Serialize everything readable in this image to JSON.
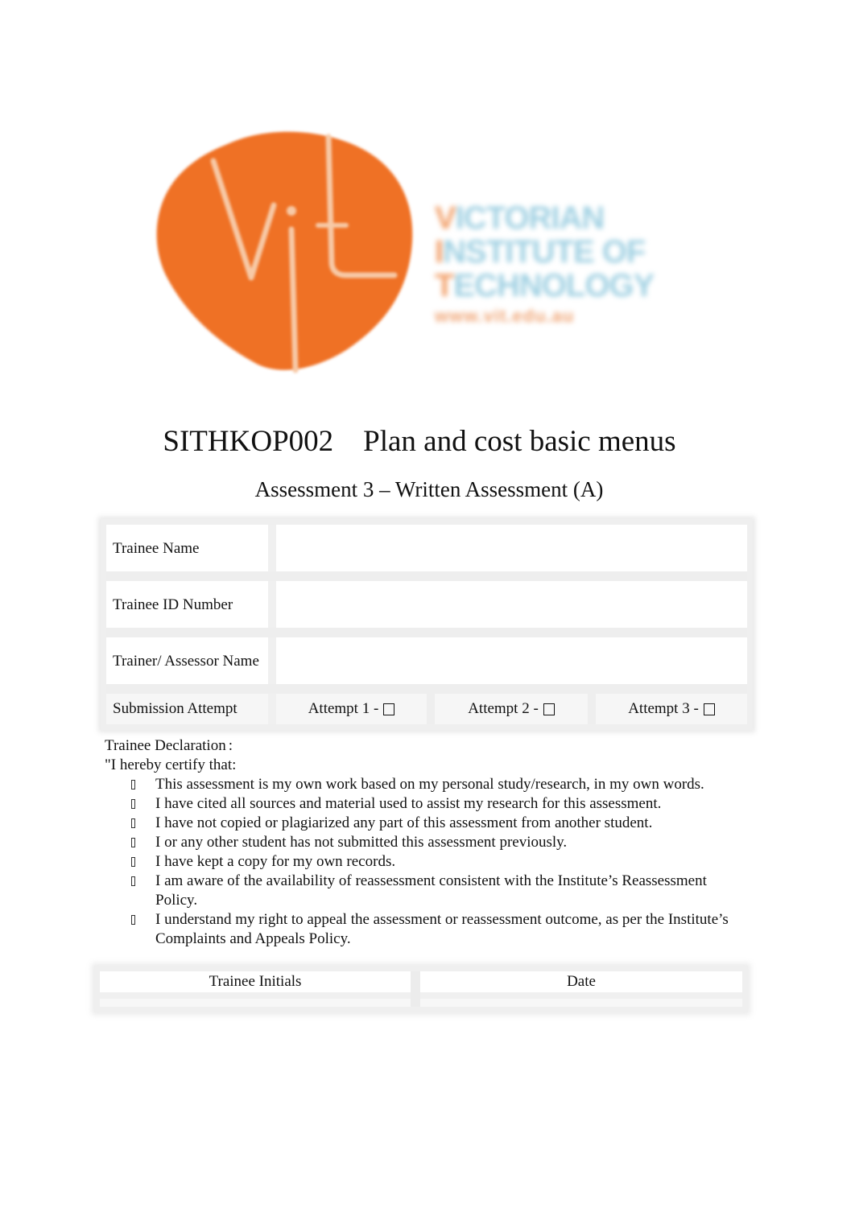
{
  "logo": {
    "initials": "vit",
    "name_lines": [
      {
        "initial": "V",
        "rest": "ICTORIAN"
      },
      {
        "initial": "I",
        "rest": "NSTITUTE OF"
      },
      {
        "initial": "T",
        "rest": "ECHNOLOGY"
      }
    ],
    "url": "www.vit.edu.au",
    "colors": {
      "mark": "#ef7125",
      "text": "#9fd0e2",
      "accent": "#f2a06a"
    }
  },
  "header": {
    "unit_code_title": "SITHKOP002    Plan and cost basic menus",
    "subtitle": "Assessment 3 – Written Assessment (A)"
  },
  "info_table": {
    "rows": [
      {
        "label": "Trainee Name",
        "value": ""
      },
      {
        "label": "Trainee ID Number",
        "value": ""
      },
      {
        "label": "Trainer/ Assessor Name",
        "value": ""
      }
    ],
    "submission": {
      "label": "Submission Attempt",
      "attempts": [
        {
          "label": "Attempt 1 - ",
          "checked": false
        },
        {
          "label": "Attempt 2 - ",
          "checked": false
        },
        {
          "label": "Attempt 3 - ",
          "checked": false
        }
      ]
    }
  },
  "declaration": {
    "heading": "Trainee Declaration",
    "heading_colon": ":",
    "intro": "\"I hereby certify that:",
    "items": [
      "This assessment is my own work based on my personal study/research, in my own words.",
      "I have cited all sources and material used to assist my research for this assessment.",
      "I have not copied or plagiarized any part of this assessment from another student.",
      "I or any other student has not submitted this assessment previously.",
      "I have kept a copy for my own records.",
      "I am aware of the availability of reassessment consistent with the Institute’s Reassessment Policy.",
      "I understand my right to appeal the assessment or reassessment outcome, as per the Institute’s Complaints and Appeals Policy."
    ]
  },
  "sign_table": {
    "initials_label": "Trainee Initials",
    "initials_value": "",
    "date_label": "Date",
    "date_value": ""
  }
}
